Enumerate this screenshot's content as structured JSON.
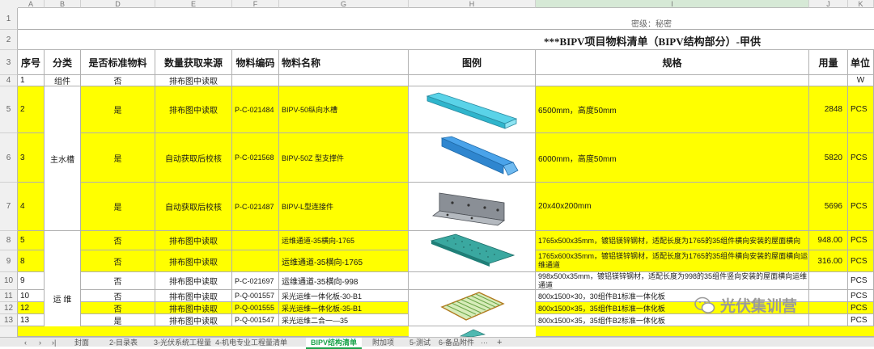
{
  "column_letters": [
    "A",
    "B",
    "D",
    "E",
    "F",
    "G",
    "H",
    "I",
    "J",
    "K"
  ],
  "row_numbers": [
    "1",
    "2",
    "3",
    "4",
    "5",
    "6",
    "7",
    "8",
    "9",
    "10",
    "11",
    "12",
    "13"
  ],
  "security_label": "密级：秘密",
  "sheet_title": "***BIPV项目物料清单（BIPV结构部分）-甲供",
  "headers": {
    "seq": "序号",
    "category": "分类",
    "standard": "是否标准物料",
    "qty_source": "数量获取来源",
    "code": "物料编码",
    "name": "物料名称",
    "image": "图例",
    "spec": "规格",
    "usage": "用量",
    "unit": "单位"
  },
  "groups": {
    "main_gutter": "主水槽",
    "maintenance": "运\n维"
  },
  "rows": [
    {
      "seq": "1",
      "category": "组件",
      "standard": "否",
      "source": "排布图中读取",
      "code": "",
      "name": "",
      "spec": "",
      "usage": "",
      "unit": "W"
    },
    {
      "seq": "2",
      "standard": "是",
      "source": "排布图中读取",
      "code": "P-C-021484",
      "name": "BIPV-50纵向水槽",
      "spec": "6500mm，高度50mm",
      "usage": "2848",
      "unit": "PCS"
    },
    {
      "seq": "3",
      "standard": "是",
      "source": "自动获取后校核",
      "code": "P-C-021568",
      "name": "BIPV-50Z 型支撑件",
      "spec": "6000mm，高度50mm",
      "usage": "5820",
      "unit": "PCS"
    },
    {
      "seq": "4",
      "standard": "是",
      "source": "自动获取后校核",
      "code": "P-C-021487",
      "name": "BIPV-L型连接件",
      "spec": "20x40x200mm",
      "usage": "5696",
      "unit": "PCS"
    },
    {
      "seq": "5",
      "standard": "否",
      "source": "排布图中读取",
      "code": "",
      "name": "运维通道-35横向-1765",
      "spec": "1765x500x35mm，镀铝镁锌钢材，适配长度为1765的35组件横向安装的屋面横向",
      "usage": "948.00",
      "unit": "PCS"
    },
    {
      "seq": "8",
      "standard": "否",
      "source": "排布图中读取",
      "code": "",
      "name": "运维通道-35横向-1765",
      "spec": "1765x600x35mm，镀铝镁锌钢材，适配长度为1765的35组件横向安装的屋面横向运维通道",
      "usage": "316.00",
      "unit": "PCS"
    },
    {
      "seq": "9",
      "standard": "否",
      "source": "排布图中读取",
      "code": "P-C-021697",
      "name": "运维通道-35横向-998",
      "spec": "998x500x35mm，镀铝镁锌钢材，适配长度为998的35组件竖向安装的屋面横向运维通道",
      "usage": "",
      "unit": "PCS"
    },
    {
      "seq": "10",
      "standard": "否",
      "source": "排布图中读取",
      "code": "P-Q-001557",
      "name": "采光运维一体化板-30-B1",
      "spec": "800x1500×30，30组件B1标准一体化板",
      "usage": "",
      "unit": "PCS"
    },
    {
      "seq": "12",
      "standard": "否",
      "source": "排布图中读取",
      "code": "P-Q-001555",
      "name": "采光运维一体化板-35-B1",
      "spec": "800x1500×35，35组件B1标准一体化板",
      "usage": "",
      "unit": "PCS"
    },
    {
      "seq": "13",
      "standard": "是",
      "source": "排布图中读取",
      "code": "P-Q-001547",
      "name": "采光运维二合一—35",
      "spec": "800x1500×35，35组件B2标准一体化板",
      "usage": "",
      "unit": "PCS"
    }
  ],
  "watermark": "光伏集训营",
  "sheet_tabs": [
    "封面",
    "2-目录表",
    "3-光伏系统工程量",
    "4-机电专业工程量清单",
    "BIPV结构清单",
    "附加项",
    "5-测试",
    "6-备品附件"
  ],
  "nav_glyphs": {
    "prev": "‹",
    "next": "›",
    "last": "›|",
    "more": "···",
    "add": "+"
  }
}
